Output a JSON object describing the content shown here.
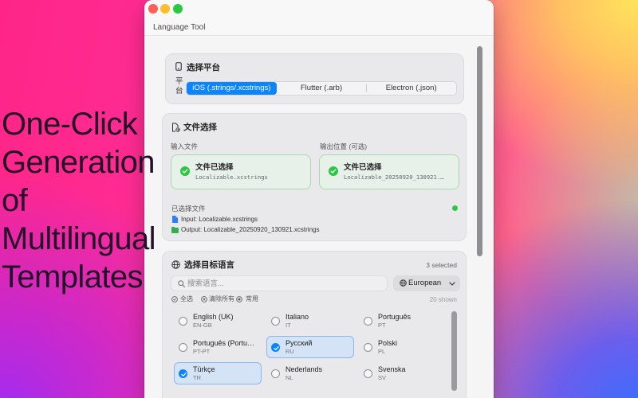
{
  "hero_lines": [
    "One-Click",
    "Generation",
    "of",
    "Multilingual",
    "Templates"
  ],
  "window": {
    "title": "Language Tool"
  },
  "platform": {
    "title": "选择平台",
    "field_label": "平台",
    "segments": [
      {
        "label": "iOS (.strings/.xcstrings)",
        "selected": true
      },
      {
        "label": "Flutter (.arb)",
        "selected": false
      },
      {
        "label": "Electron (.json)",
        "selected": false
      }
    ]
  },
  "files": {
    "title": "文件选择",
    "input_label": "输入文件",
    "output_label": "输出位置 (可选)",
    "input": {
      "status": "文件已选择",
      "name": "Localizable.xcstrings"
    },
    "output": {
      "status": "文件已选择",
      "name": "Localizable_20250920_130921.…"
    },
    "selected_title": "已选择文件",
    "selected_input": "Input: Localizable.xcstrings",
    "selected_output": "Output: Localizable_20250920_130921.xcstrings"
  },
  "languages": {
    "title": "选择目标语言",
    "selected_count": "3 selected",
    "search_placeholder": "搜索语言...",
    "region_filter": "European",
    "actions": [
      "全选",
      "清除所有",
      "常用"
    ],
    "shown_count": "20 shown",
    "items": [
      {
        "name": "English (UK)",
        "code": "EN-GB",
        "selected": false
      },
      {
        "name": "Italiano",
        "code": "IT",
        "selected": false
      },
      {
        "name": "Português",
        "code": "PT",
        "selected": false
      },
      {
        "name": "Português (Portu…",
        "code": "PT-PT",
        "selected": false
      },
      {
        "name": "Русский",
        "code": "RU",
        "selected": true
      },
      {
        "name": "Polski",
        "code": "PL",
        "selected": false
      },
      {
        "name": "Türkçe",
        "code": "TR",
        "selected": true
      },
      {
        "name": "Nederlands",
        "code": "NL",
        "selected": false
      },
      {
        "name": "Svenska",
        "code": "SV",
        "selected": false
      }
    ]
  },
  "colors": {
    "accent": "#0a84ff",
    "success": "#28c840",
    "traffic_close": "#ff5f57",
    "traffic_minimize": "#febc2e",
    "traffic_zoom": "#28c840"
  },
  "icons": {
    "platform": "phone-icon",
    "files": "file-transfer-icon",
    "file_selected": "check-circle-icon",
    "input_file": "document-icon",
    "output_file": "folder-icon",
    "languages": "globe-icon",
    "search": "search-icon",
    "region_filter": "globe-icon",
    "dropdown": "chevron-down-icon",
    "select_all": "check-circle-outline-icon",
    "clear_all": "x-circle-outline-icon",
    "common": "radio-dot-icon"
  }
}
